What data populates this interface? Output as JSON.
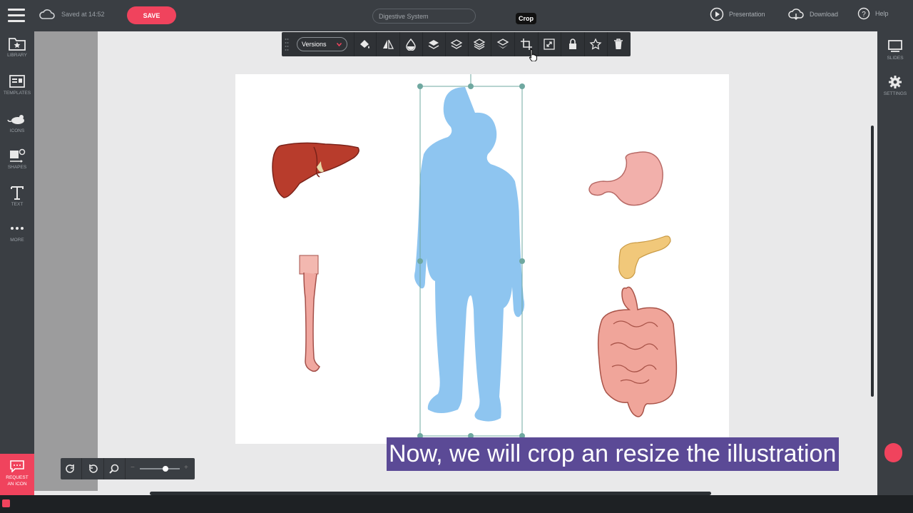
{
  "topbar": {
    "saved_text": "Saved at 14:52",
    "save_label": "SAVE",
    "document_title": "Digestive System",
    "presentation_label": "Presentation",
    "download_label": "Download",
    "help_label": "Help"
  },
  "sidebar": {
    "items": [
      {
        "label": "LIBRARY",
        "icon": "folder-star-icon"
      },
      {
        "label": "TEMPLATES",
        "icon": "template-icon"
      },
      {
        "label": "ICONS",
        "icon": "mouse-icon"
      },
      {
        "label": "SHAPES",
        "icon": "shapes-icon"
      },
      {
        "label": "TEXT",
        "icon": "text-icon"
      },
      {
        "label": "MORE",
        "icon": "more-icon"
      }
    ],
    "request_label_line1": "REQUEST",
    "request_label_line2": "AN ICON"
  },
  "rightbar": {
    "slides_label": "SLIDES",
    "settings_label": "SETTINGS"
  },
  "toolbar": {
    "versions_label": "Versions",
    "tooltip": "Crop",
    "icons": [
      "fill-color-icon",
      "flip-icon",
      "opacity-icon",
      "bring-to-front-icon",
      "bring-forward-icon",
      "send-backward-icon",
      "send-to-back-icon",
      "crop-icon",
      "resize-icon",
      "lock-icon",
      "favorite-star-icon",
      "delete-icon"
    ]
  },
  "colors": {
    "accent": "#f0435d",
    "silhouette": "#8ec5f0",
    "caption_bg": "#5b4a96",
    "selection": "#6fa8a0"
  },
  "caption": "Now, we will crop an resize the illustration"
}
